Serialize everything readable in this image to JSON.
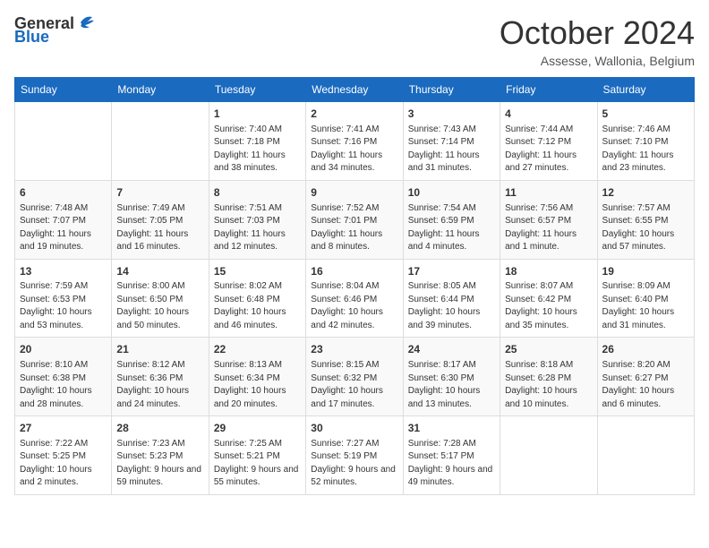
{
  "logo": {
    "general": "General",
    "blue": "Blue"
  },
  "header": {
    "month": "October 2024",
    "location": "Assesse, Wallonia, Belgium"
  },
  "days_of_week": [
    "Sunday",
    "Monday",
    "Tuesday",
    "Wednesday",
    "Thursday",
    "Friday",
    "Saturday"
  ],
  "weeks": [
    [
      {
        "day": "",
        "sunrise": "",
        "sunset": "",
        "daylight": ""
      },
      {
        "day": "",
        "sunrise": "",
        "sunset": "",
        "daylight": ""
      },
      {
        "day": "1",
        "sunrise": "Sunrise: 7:40 AM",
        "sunset": "Sunset: 7:18 PM",
        "daylight": "Daylight: 11 hours and 38 minutes."
      },
      {
        "day": "2",
        "sunrise": "Sunrise: 7:41 AM",
        "sunset": "Sunset: 7:16 PM",
        "daylight": "Daylight: 11 hours and 34 minutes."
      },
      {
        "day": "3",
        "sunrise": "Sunrise: 7:43 AM",
        "sunset": "Sunset: 7:14 PM",
        "daylight": "Daylight: 11 hours and 31 minutes."
      },
      {
        "day": "4",
        "sunrise": "Sunrise: 7:44 AM",
        "sunset": "Sunset: 7:12 PM",
        "daylight": "Daylight: 11 hours and 27 minutes."
      },
      {
        "day": "5",
        "sunrise": "Sunrise: 7:46 AM",
        "sunset": "Sunset: 7:10 PM",
        "daylight": "Daylight: 11 hours and 23 minutes."
      }
    ],
    [
      {
        "day": "6",
        "sunrise": "Sunrise: 7:48 AM",
        "sunset": "Sunset: 7:07 PM",
        "daylight": "Daylight: 11 hours and 19 minutes."
      },
      {
        "day": "7",
        "sunrise": "Sunrise: 7:49 AM",
        "sunset": "Sunset: 7:05 PM",
        "daylight": "Daylight: 11 hours and 16 minutes."
      },
      {
        "day": "8",
        "sunrise": "Sunrise: 7:51 AM",
        "sunset": "Sunset: 7:03 PM",
        "daylight": "Daylight: 11 hours and 12 minutes."
      },
      {
        "day": "9",
        "sunrise": "Sunrise: 7:52 AM",
        "sunset": "Sunset: 7:01 PM",
        "daylight": "Daylight: 11 hours and 8 minutes."
      },
      {
        "day": "10",
        "sunrise": "Sunrise: 7:54 AM",
        "sunset": "Sunset: 6:59 PM",
        "daylight": "Daylight: 11 hours and 4 minutes."
      },
      {
        "day": "11",
        "sunrise": "Sunrise: 7:56 AM",
        "sunset": "Sunset: 6:57 PM",
        "daylight": "Daylight: 11 hours and 1 minute."
      },
      {
        "day": "12",
        "sunrise": "Sunrise: 7:57 AM",
        "sunset": "Sunset: 6:55 PM",
        "daylight": "Daylight: 10 hours and 57 minutes."
      }
    ],
    [
      {
        "day": "13",
        "sunrise": "Sunrise: 7:59 AM",
        "sunset": "Sunset: 6:53 PM",
        "daylight": "Daylight: 10 hours and 53 minutes."
      },
      {
        "day": "14",
        "sunrise": "Sunrise: 8:00 AM",
        "sunset": "Sunset: 6:50 PM",
        "daylight": "Daylight: 10 hours and 50 minutes."
      },
      {
        "day": "15",
        "sunrise": "Sunrise: 8:02 AM",
        "sunset": "Sunset: 6:48 PM",
        "daylight": "Daylight: 10 hours and 46 minutes."
      },
      {
        "day": "16",
        "sunrise": "Sunrise: 8:04 AM",
        "sunset": "Sunset: 6:46 PM",
        "daylight": "Daylight: 10 hours and 42 minutes."
      },
      {
        "day": "17",
        "sunrise": "Sunrise: 8:05 AM",
        "sunset": "Sunset: 6:44 PM",
        "daylight": "Daylight: 10 hours and 39 minutes."
      },
      {
        "day": "18",
        "sunrise": "Sunrise: 8:07 AM",
        "sunset": "Sunset: 6:42 PM",
        "daylight": "Daylight: 10 hours and 35 minutes."
      },
      {
        "day": "19",
        "sunrise": "Sunrise: 8:09 AM",
        "sunset": "Sunset: 6:40 PM",
        "daylight": "Daylight: 10 hours and 31 minutes."
      }
    ],
    [
      {
        "day": "20",
        "sunrise": "Sunrise: 8:10 AM",
        "sunset": "Sunset: 6:38 PM",
        "daylight": "Daylight: 10 hours and 28 minutes."
      },
      {
        "day": "21",
        "sunrise": "Sunrise: 8:12 AM",
        "sunset": "Sunset: 6:36 PM",
        "daylight": "Daylight: 10 hours and 24 minutes."
      },
      {
        "day": "22",
        "sunrise": "Sunrise: 8:13 AM",
        "sunset": "Sunset: 6:34 PM",
        "daylight": "Daylight: 10 hours and 20 minutes."
      },
      {
        "day": "23",
        "sunrise": "Sunrise: 8:15 AM",
        "sunset": "Sunset: 6:32 PM",
        "daylight": "Daylight: 10 hours and 17 minutes."
      },
      {
        "day": "24",
        "sunrise": "Sunrise: 8:17 AM",
        "sunset": "Sunset: 6:30 PM",
        "daylight": "Daylight: 10 hours and 13 minutes."
      },
      {
        "day": "25",
        "sunrise": "Sunrise: 8:18 AM",
        "sunset": "Sunset: 6:28 PM",
        "daylight": "Daylight: 10 hours and 10 minutes."
      },
      {
        "day": "26",
        "sunrise": "Sunrise: 8:20 AM",
        "sunset": "Sunset: 6:27 PM",
        "daylight": "Daylight: 10 hours and 6 minutes."
      }
    ],
    [
      {
        "day": "27",
        "sunrise": "Sunrise: 7:22 AM",
        "sunset": "Sunset: 5:25 PM",
        "daylight": "Daylight: 10 hours and 2 minutes."
      },
      {
        "day": "28",
        "sunrise": "Sunrise: 7:23 AM",
        "sunset": "Sunset: 5:23 PM",
        "daylight": "Daylight: 9 hours and 59 minutes."
      },
      {
        "day": "29",
        "sunrise": "Sunrise: 7:25 AM",
        "sunset": "Sunset: 5:21 PM",
        "daylight": "Daylight: 9 hours and 55 minutes."
      },
      {
        "day": "30",
        "sunrise": "Sunrise: 7:27 AM",
        "sunset": "Sunset: 5:19 PM",
        "daylight": "Daylight: 9 hours and 52 minutes."
      },
      {
        "day": "31",
        "sunrise": "Sunrise: 7:28 AM",
        "sunset": "Sunset: 5:17 PM",
        "daylight": "Daylight: 9 hours and 49 minutes."
      },
      {
        "day": "",
        "sunrise": "",
        "sunset": "",
        "daylight": ""
      },
      {
        "day": "",
        "sunrise": "",
        "sunset": "",
        "daylight": ""
      }
    ]
  ]
}
